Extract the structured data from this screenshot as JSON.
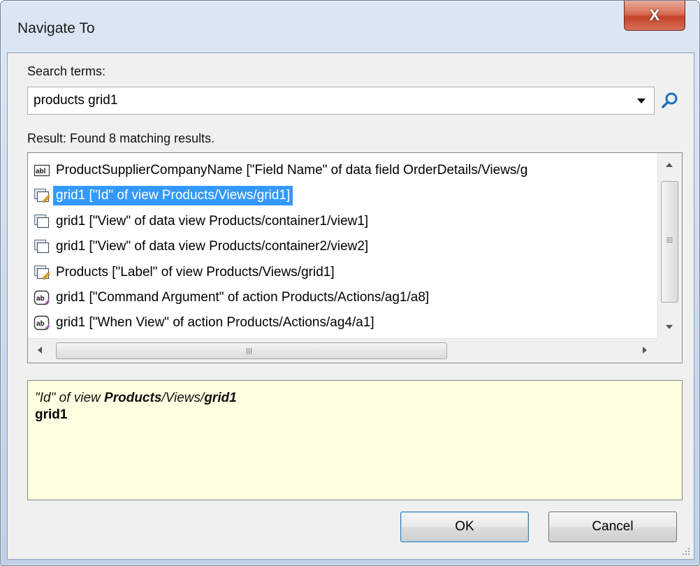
{
  "window": {
    "title": "Navigate To",
    "close_label": "X"
  },
  "search": {
    "label": "Search terms:",
    "value": "products grid1"
  },
  "results": {
    "label": "Result: Found 8 matching results.",
    "items": [
      {
        "icon": "field-abl-icon",
        "text": "ProductSupplierCompanyName [\"Field Name\" of data field OrderDetails/Views/g"
      },
      {
        "icon": "view-edit-icon",
        "text": "grid1 [\"Id\" of view Products/Views/grid1]",
        "selected": true
      },
      {
        "icon": "data-view-icon",
        "text": "grid1 [\"View\" of data view Products/container1/view1]"
      },
      {
        "icon": "data-view-icon",
        "text": "grid1 [\"View\" of data view Products/container2/view2]"
      },
      {
        "icon": "view-edit-icon",
        "text": "Products [\"Label\" of view Products/Views/grid1]"
      },
      {
        "icon": "action-ab-icon",
        "text": "grid1 [\"Command Argument\" of action Products/Actions/ag1/a8]"
      },
      {
        "icon": "action-ab-icon",
        "text": "grid1 [\"When View\" of action Products/Actions/ag4/a1]"
      }
    ]
  },
  "details": {
    "quoted": "\"Id\"",
    "middle": " of view ",
    "bold1": "Products",
    "path": "/Views/",
    "bold2": "grid1",
    "value": "grid1"
  },
  "buttons": {
    "ok": "OK",
    "cancel": "Cancel"
  },
  "colors": {
    "selection": "#3399ff",
    "info_bg": "#ffffe1"
  }
}
